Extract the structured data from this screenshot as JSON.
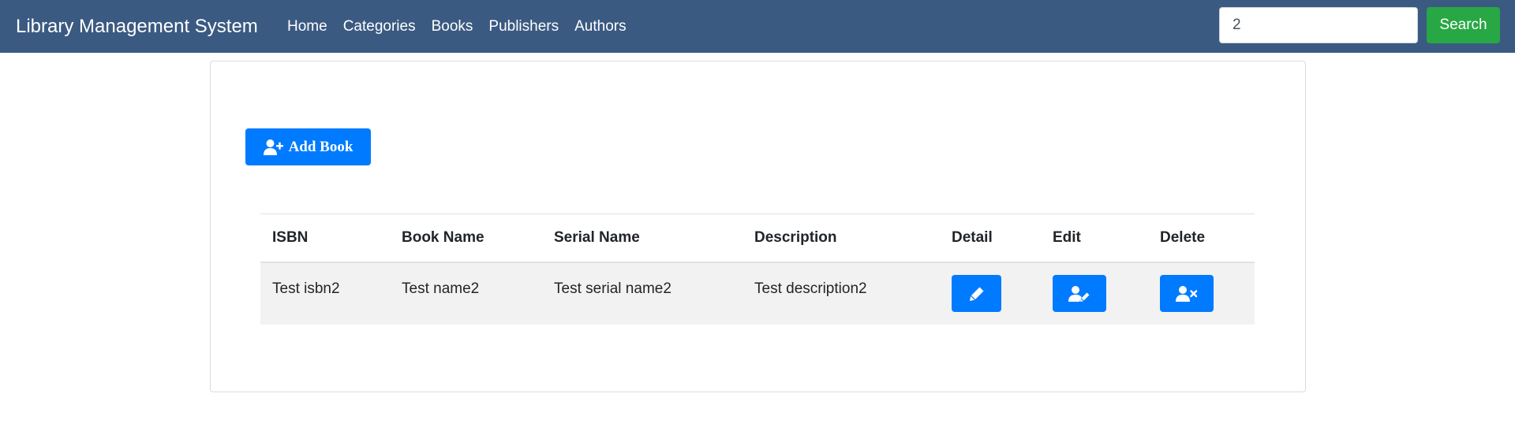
{
  "navbar": {
    "brand": "Library Management System",
    "links": [
      "Home",
      "Categories",
      "Books",
      "Publishers",
      "Authors"
    ],
    "search_value": "2",
    "search_button": "Search"
  },
  "toolbar": {
    "add_book_label": "Add Book",
    "add_book_icon": "user-plus-icon"
  },
  "table": {
    "headers": [
      "ISBN",
      "Book Name",
      "Serial Name",
      "Description",
      "Detail",
      "Edit",
      "Delete"
    ],
    "rows": [
      {
        "isbn": "Test isbn2",
        "book_name": "Test name2",
        "serial_name": "Test serial name2",
        "description": "Test description2",
        "detail_icon": "pen-icon",
        "edit_icon": "user-edit-icon",
        "delete_icon": "user-remove-icon"
      }
    ]
  },
  "colors": {
    "navbar_bg": "#3b5a82",
    "primary": "#007bff",
    "success": "#28a745",
    "row_bg": "#f2f2f2"
  }
}
